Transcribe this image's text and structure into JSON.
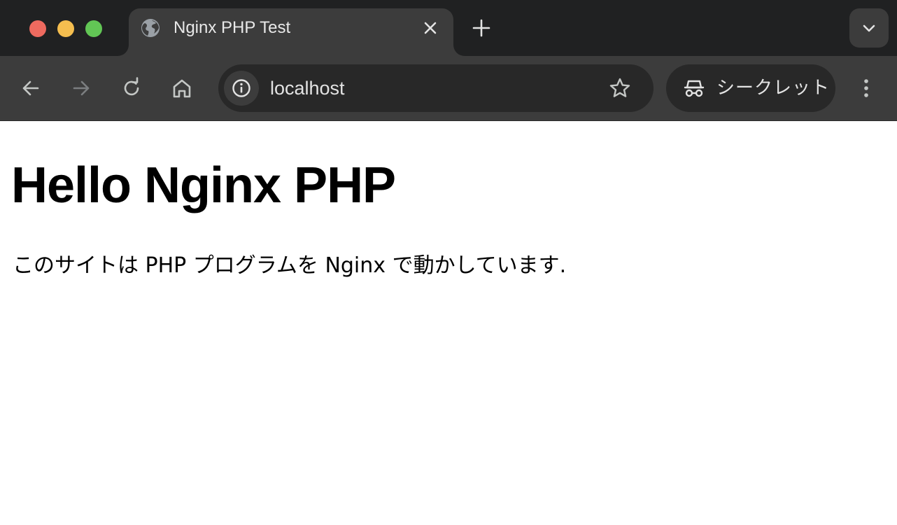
{
  "browser": {
    "tab": {
      "title": "Nginx PHP Test",
      "favicon": "globe-icon"
    },
    "address_bar": {
      "url": "localhost"
    },
    "incognito": {
      "label": "シークレット"
    },
    "icons": {
      "back": "arrow-left-icon",
      "forward": "arrow-right-icon",
      "reload": "reload-icon",
      "home": "home-icon",
      "site_info": "info-icon",
      "bookmark": "star-icon",
      "menu": "kebab-menu-icon",
      "new_tab": "plus-icon",
      "tab_search": "chevron-down-icon",
      "close_tab": "close-icon"
    },
    "colors": {
      "tabstrip": "#202122",
      "toolbar": "#3c3c3c",
      "omnibox": "#282828",
      "close": "#ee6a5f",
      "minimize": "#f5be4f",
      "zoom": "#62c655"
    }
  },
  "page": {
    "heading": "Hello Nginx PHP",
    "text": "このサイトは PHP プログラムを Nginx で動かしています."
  }
}
